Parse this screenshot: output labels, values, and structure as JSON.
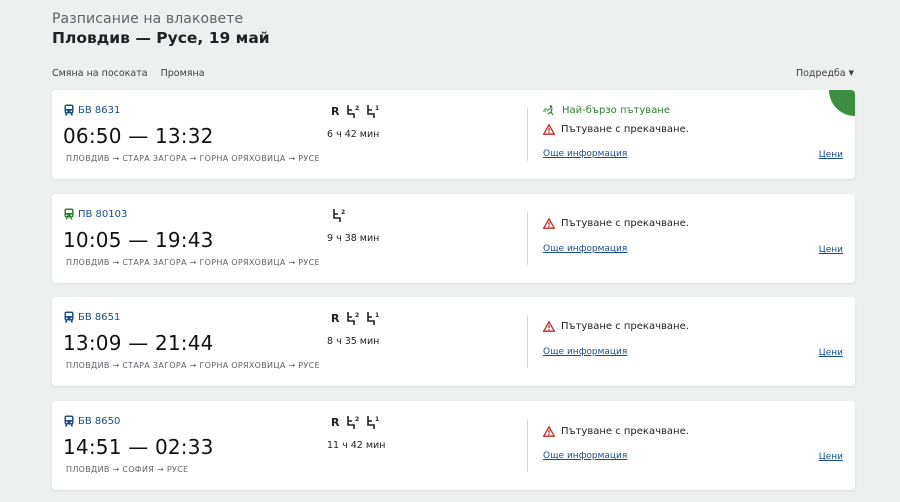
{
  "header": {
    "subtitle": "Разписание на влаковете",
    "title": "Пловдив — Русе, 19 май"
  },
  "toolbar": {
    "swap_direction": "Смяна на посоката",
    "change": "Промяна",
    "sort": "Подредба"
  },
  "links": {
    "more_info": "Още информация",
    "prices": "Цени"
  },
  "trains": [
    {
      "id": "БВ 8631",
      "icon": "bus-icon",
      "icon_color": "#1a4f8b",
      "times": "06:50 — 13:32",
      "route": "ПЛОВДИВ → СТАРА ЗАГОРА → ГОРНА ОРЯХОВИЦА → РУСЕ",
      "duration": "6 ч 42 мин",
      "amenities": [
        "R",
        "seat-class-2-icon",
        "seat-class-1-icon"
      ],
      "fastest": "Най-бързо пътуване",
      "warning": "Пътуване с прекачване."
    },
    {
      "id": "ПВ 80103",
      "icon": "train-icon",
      "icon_color": "#2e7d32",
      "times": "10:05 — 19:43",
      "route": "ПЛОВДИВ → СТАРА ЗАГОРА → ГОРНА ОРЯХОВИЦА → РУСЕ",
      "duration": "9 ч 38 мин",
      "amenities": [
        "seat-class-2-icon"
      ],
      "warning": "Пътуване с прекачване."
    },
    {
      "id": "БВ 8651",
      "icon": "bus-icon",
      "icon_color": "#1a4f8b",
      "times": "13:09 — 21:44",
      "route": "ПЛОВДИВ → СТАРА ЗАГОРА → ГОРНА ОРЯХОВИЦА → РУСЕ",
      "duration": "8 ч 35 мин",
      "amenities": [
        "R",
        "seat-class-2-icon",
        "seat-class-1-icon"
      ],
      "warning": "Пътуване с прекачване."
    },
    {
      "id": "БВ 8650",
      "icon": "bus-icon",
      "icon_color": "#1a4f8b",
      "times": "14:51 — 02:33",
      "route": "ПЛОВДИВ → СОФИЯ → РУСЕ",
      "duration": "11 ч 42 мин",
      "amenities": [
        "R",
        "seat-class-2-icon",
        "seat-class-1-icon"
      ],
      "warning": "Пътуване с прекачване."
    }
  ],
  "colors": {
    "accent_blue": "#1a4f8b",
    "fastest_green": "#2e7d32",
    "warning_red": "#c62828",
    "background": "#eef0ef"
  }
}
